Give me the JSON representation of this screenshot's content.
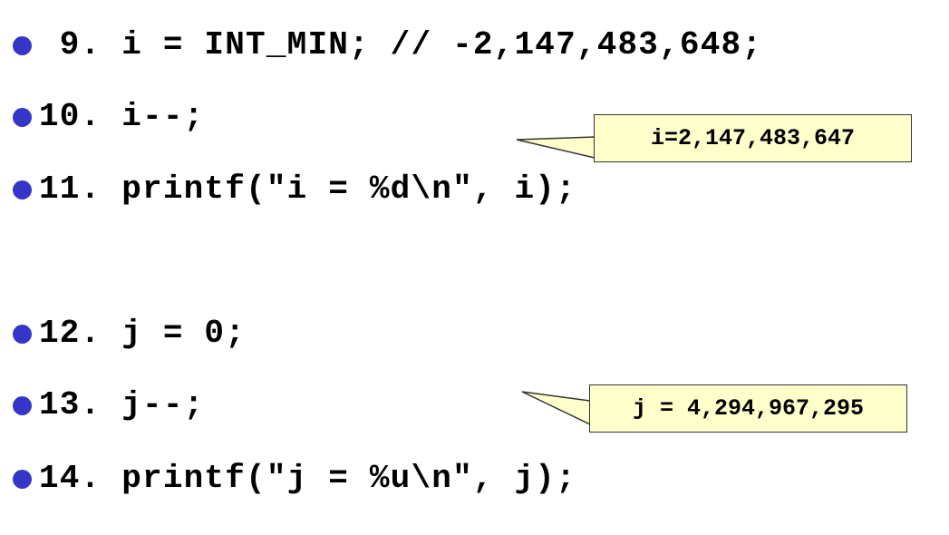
{
  "colors": {
    "bullet": "#3535c8",
    "code_text": "#000000",
    "callout_fill": "#ffffcc",
    "callout_border": "#333333"
  },
  "code_lines": [
    {
      "label": " 9. i = INT_MIN; // -2,147,483,648;"
    },
    {
      "label": "10. i--;"
    },
    {
      "label": "11. printf(\"i = %d\\n\", i);"
    },
    {
      "label": "12. j = 0;"
    },
    {
      "label": "13. j--;"
    },
    {
      "label": "14. printf(\"j = %u\\n\", j);"
    }
  ],
  "callouts": [
    {
      "text": "i=2,147,483,647"
    },
    {
      "text": "j = 4,294,967,295"
    }
  ]
}
